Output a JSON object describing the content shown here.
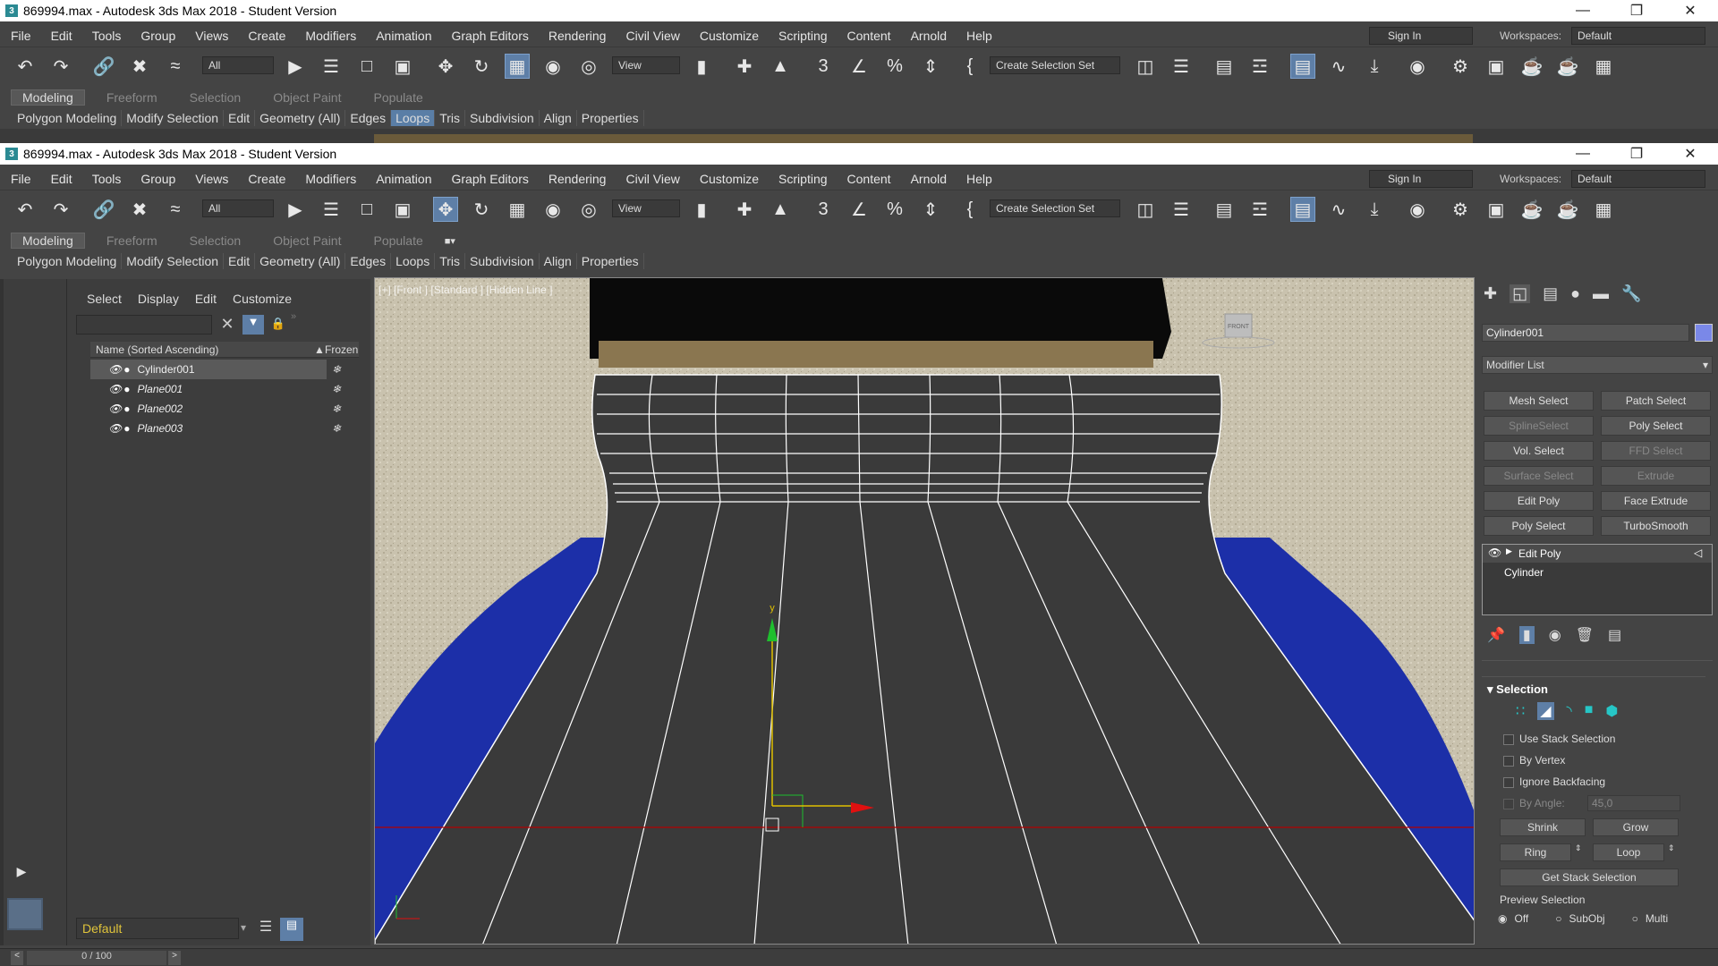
{
  "window_title": "869994.max - Autodesk 3ds Max 2018 - Student Version",
  "menus": [
    "File",
    "Edit",
    "Tools",
    "Group",
    "Views",
    "Create",
    "Modifiers",
    "Animation",
    "Graph Editors",
    "Rendering",
    "Civil View",
    "Customize",
    "Scripting",
    "Content",
    "Arnold",
    "Help"
  ],
  "sign_in": "Sign In",
  "workspaces_label": "Workspaces:",
  "workspace_value": "Default",
  "filter_value": "All",
  "refcoord_value": "View",
  "selection_set": "Create Selection Set",
  "ribbon_tabs": [
    "Modeling",
    "Freeform",
    "Selection",
    "Object Paint",
    "Populate"
  ],
  "ribbon_panels": [
    "Polygon Modeling",
    "Modify Selection",
    "Edit",
    "Geometry (All)",
    "Edges",
    "Loops",
    "Tris",
    "Subdivision",
    "Align",
    "Properties"
  ],
  "scene_explorer": {
    "menus": [
      "Select",
      "Display",
      "Edit",
      "Customize"
    ],
    "col_name": "Name (Sorted Ascending)",
    "col_frozen": "Frozen",
    "items": [
      "Cylinder001",
      "Plane001",
      "Plane002",
      "Plane003"
    ],
    "layer": "Default"
  },
  "viewport": {
    "label": "[+] [Front ] [Standard ] [Hidden Line ]",
    "gizmo_y": "y",
    "viewcube": "FRONT"
  },
  "command_panel": {
    "object_name": "Cylinder001",
    "modifier_list": "Modifier List",
    "modifier_buttons": [
      "Mesh Select",
      "Patch Select",
      "SplineSelect",
      "Poly Select",
      "Vol. Select",
      "FFD Select",
      "Surface Select",
      "Extrude",
      "Edit Poly",
      "Face Extrude",
      "Poly Select",
      "TurboSmooth"
    ],
    "stack": [
      "Edit Poly",
      "Cylinder"
    ],
    "rollout_title": "Selection",
    "use_stack": "Use Stack Selection",
    "by_vertex": "By Vertex",
    "ignore_backfacing": "Ignore Backfacing",
    "by_angle": "By Angle:",
    "angle_value": "45,0",
    "shrink": "Shrink",
    "grow": "Grow",
    "ring": "Ring",
    "loop": "Loop",
    "get_stack": "Get Stack Selection",
    "preview_selection": "Preview Selection",
    "preview_options": [
      "Off",
      "SubObj",
      "Multi"
    ]
  },
  "timeline": "0 / 100"
}
